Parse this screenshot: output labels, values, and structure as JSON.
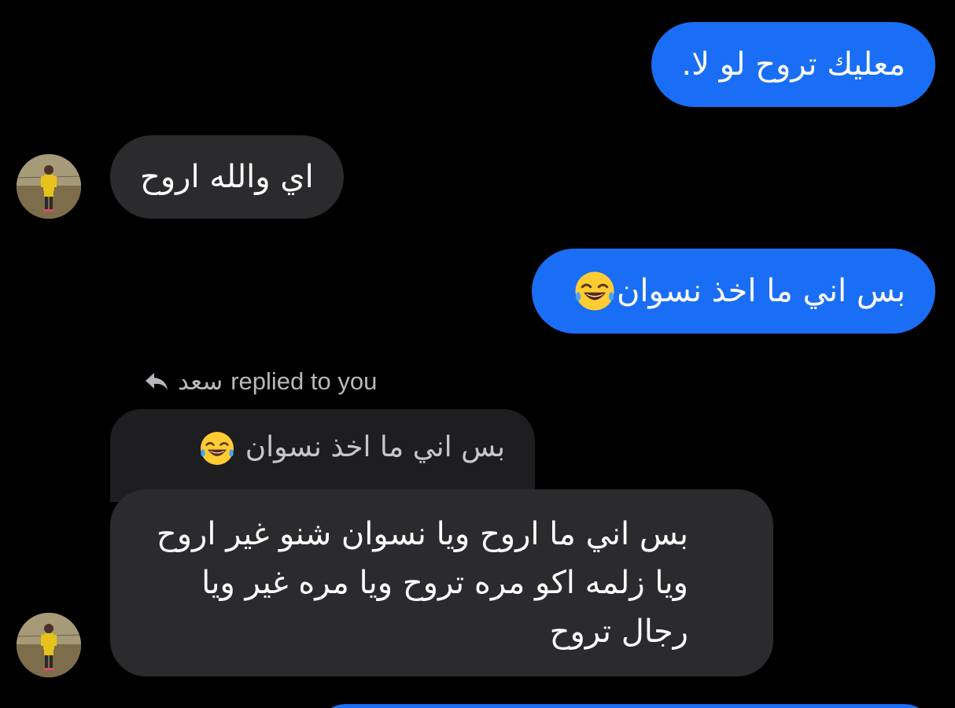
{
  "messages": {
    "m1": {
      "text": "معليك تروح لو لا."
    },
    "m2": {
      "text": "اي والله اروح"
    },
    "m3": {
      "text": "بس اني ما اخذ نسوان",
      "emoji": "face-with-tears-of-joy"
    },
    "reply": {
      "sender": "سعد",
      "label": "replied to you",
      "quoted_text": "بس اني ما اخذ نسوان",
      "text": "بس اني ما اروح ويا نسوان شنو غير اروح ويا زلمه اكو مره تروح ويا مره غير ويا رجال تروح"
    }
  },
  "colors": {
    "background": "#000000",
    "outgoing_bubble": "#1a6ef5",
    "incoming_bubble": "#2b2b2d",
    "quoted_bubble": "#1e1e20"
  }
}
